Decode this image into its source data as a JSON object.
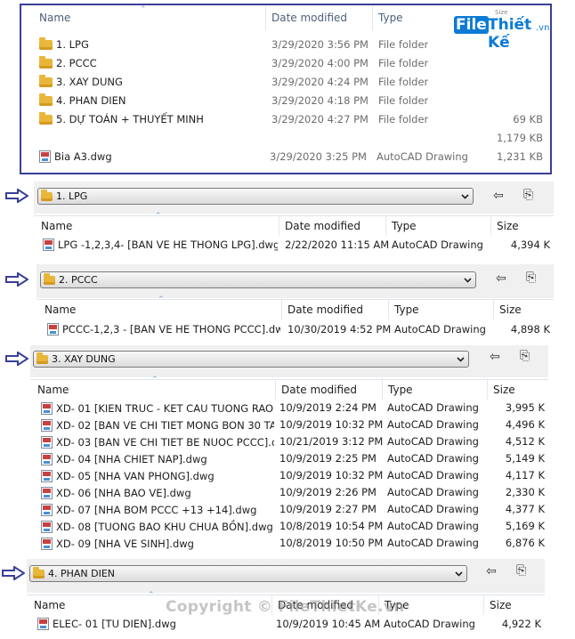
{
  "top_panel": {
    "columns": {
      "name": "Name",
      "date": "Date modified",
      "type": "Type"
    },
    "rows": [
      {
        "name": "1. LPG",
        "date": "3/29/2020 3:56 PM",
        "type": "File folder",
        "size": "",
        "icon": "folder-icon"
      },
      {
        "name": "2. PCCC",
        "date": "3/29/2020 4:00 PM",
        "type": "File folder",
        "size": "",
        "icon": "folder-icon"
      },
      {
        "name": "3. XAY DUNG",
        "date": "3/29/2020 4:24 PM",
        "type": "File folder",
        "size": "",
        "icon": "folder-icon"
      },
      {
        "name": "4. PHAN DIEN",
        "date": "3/29/2020 4:18 PM",
        "type": "File folder",
        "size": "",
        "icon": "folder-icon"
      },
      {
        "name": "5. DỰ TOÁN + THUYẾT MINH",
        "date": "3/29/2020 4:27 PM",
        "type": "File folder",
        "size": "69 KB",
        "icon": "folder-icon"
      },
      {
        "name": "",
        "date": "",
        "type": "",
        "size": "1,179 KB",
        "icon": ""
      },
      {
        "name": "Bia A3.dwg",
        "date": "3/29/2020 3:25 PM",
        "type": "AutoCAD Drawing",
        "size": "1,231 KB",
        "icon": "dwg-file-icon"
      }
    ]
  },
  "logo": {
    "file": "File",
    "thiet_ke": "Thiết Kế",
    "vn": ".vn",
    "size_tag": "Size"
  },
  "sections": [
    {
      "address": "1. LPG",
      "columns": {
        "name": "Name",
        "date": "Date modified",
        "type": "Type",
        "size": "Size"
      },
      "rows": [
        {
          "name": "LPG -1,2,3,4- [BAN VE HE THONG  LPG].dwg",
          "date": "2/22/2020 11:15 AM",
          "type": "AutoCAD Drawing",
          "size": "4,394 K"
        }
      ]
    },
    {
      "address": "2. PCCC",
      "columns": {
        "name": "Name",
        "date": "Date modified",
        "type": "Type",
        "size": "Size"
      },
      "rows": [
        {
          "name": "PCCC-1,2,3 - [BAN VE HE THONG PCCC].dwg",
          "date": "10/30/2019 4:52 PM",
          "type": "AutoCAD Drawing",
          "size": "4,898 K"
        }
      ]
    },
    {
      "address": "3. XAY DUNG",
      "columns": {
        "name": "Name",
        "date": "Date modified",
        "type": "Type",
        "size": "Size"
      },
      "rows": [
        {
          "name": "XD- 01 [KIEN TRUC  - KET CAU TUONG RAO...",
          "date": "10/9/2019 2:24 PM",
          "type": "AutoCAD Drawing",
          "size": "3,995 K"
        },
        {
          "name": "XD- 02 [BAN VE CHI TIET MONG BON 30 TA...",
          "date": "10/9/2019 10:32 PM",
          "type": "AutoCAD Drawing",
          "size": "4,496 K"
        },
        {
          "name": "XD- 03 [BAN VE CHI TIET BE NUOC PCCC].d...",
          "date": "10/21/2019 3:12 PM",
          "type": "AutoCAD Drawing",
          "size": "4,512 K"
        },
        {
          "name": "XD- 04 [NHA CHIET NAP].dwg",
          "date": "10/9/2019 2:25 PM",
          "type": "AutoCAD Drawing",
          "size": "5,149 K"
        },
        {
          "name": "XD- 05 [NHA VAN PHONG].dwg",
          "date": "10/9/2019 10:32 PM",
          "type": "AutoCAD Drawing",
          "size": "4,117 K"
        },
        {
          "name": "XD- 06 [NHA BAO VE].dwg",
          "date": "10/9/2019 2:26 PM",
          "type": "AutoCAD Drawing",
          "size": "2,330 K"
        },
        {
          "name": "XD- 07 [NHA BOM PCCC +13 +14].dwg",
          "date": "10/9/2019 2:27 PM",
          "type": "AutoCAD Drawing",
          "size": "4,377 K"
        },
        {
          "name": "XD- 08 [TUONG BAO KHU CHUA BỒN].dwg",
          "date": "10/8/2019 10:54 PM",
          "type": "AutoCAD Drawing",
          "size": "5,169 K"
        },
        {
          "name": "XD- 09 [NHA VE SINH].dwg",
          "date": "10/8/2019 10:50 PM",
          "type": "AutoCAD Drawing",
          "size": "6,876 K"
        }
      ]
    },
    {
      "address": "4. PHAN DIEN",
      "columns": {
        "name": "Name",
        "date": "Date modified",
        "type": "Type",
        "size": "Size"
      },
      "rows": [
        {
          "name": "ELEC- 01 [TU DIEN].dwg",
          "date": "10/9/2019 10:45 AM",
          "type": "AutoCAD Drawing",
          "size": "4,922 K"
        }
      ]
    }
  ],
  "watermark": "Copyright © FileThietKe.vn",
  "colors": {
    "frame": "#3a3f96",
    "arrow": "#3a3f96",
    "folder": "#e8b73a"
  }
}
